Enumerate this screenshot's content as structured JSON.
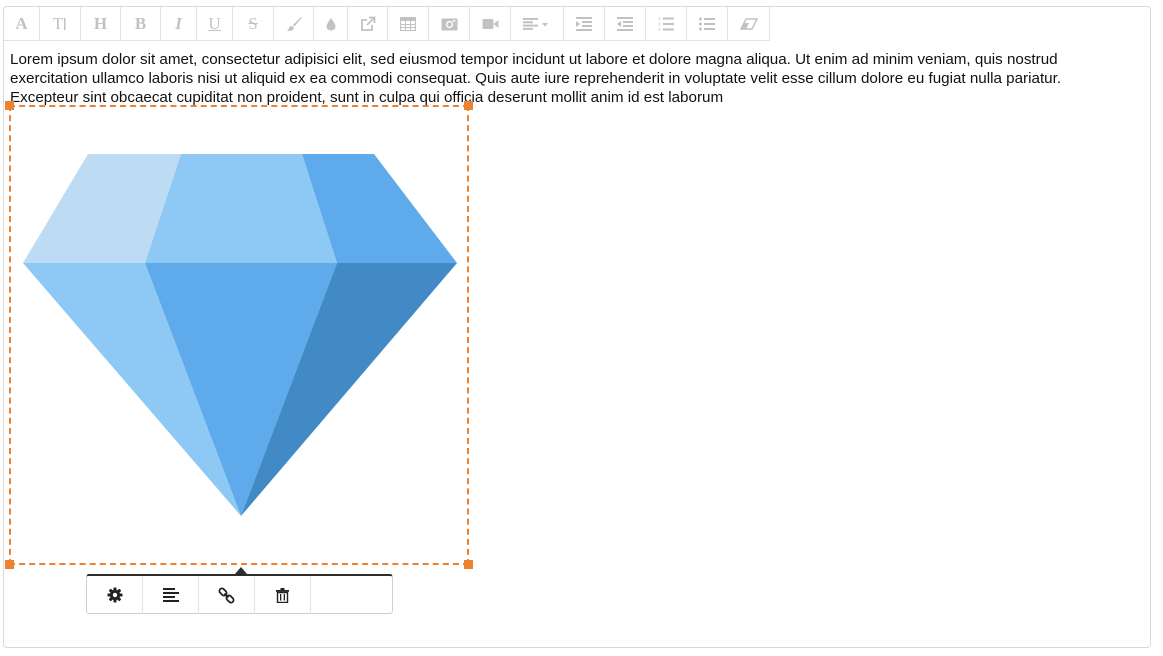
{
  "toolbar": {
    "buttons": [
      {
        "name": "font-family-button",
        "glyph": "A"
      },
      {
        "name": "font-size-button",
        "glyph": "T"
      },
      {
        "name": "heading-button",
        "glyph": "H"
      },
      {
        "name": "bold-button",
        "glyph": "B"
      },
      {
        "name": "italic-button",
        "glyph": "I"
      },
      {
        "name": "underline-button",
        "glyph": "U"
      },
      {
        "name": "strikethrough-button",
        "glyph": "S"
      },
      {
        "name": "paint-brush-button",
        "icon": "brush-icon"
      },
      {
        "name": "text-color-button",
        "icon": "droplet-icon"
      },
      {
        "name": "insert-link-button",
        "icon": "external-link-icon"
      },
      {
        "name": "insert-table-button",
        "icon": "table-icon"
      },
      {
        "name": "insert-image-button",
        "icon": "camera-icon"
      },
      {
        "name": "insert-video-button",
        "icon": "video-camera-icon"
      },
      {
        "name": "align-dropdown-button",
        "icon": "align-left-caret-icon"
      },
      {
        "name": "indent-button",
        "icon": "indent-icon"
      },
      {
        "name": "outdent-button",
        "icon": "outdent-icon"
      },
      {
        "name": "ordered-list-button",
        "icon": "ordered-list-icon"
      },
      {
        "name": "unordered-list-button",
        "icon": "unordered-list-icon"
      },
      {
        "name": "clear-format-button",
        "icon": "eraser-icon"
      }
    ]
  },
  "content": {
    "paragraph": "Lorem ipsum dolor sit amet, consectetur adipisici elit, sed eiusmod tempor incidunt ut labore et dolore magna aliqua. Ut enim ad minim veniam, quis nostrud exercitation ullamco laboris nisi ut aliquid ex ea commodi consequat. Quis aute iure reprehenderit in voluptate velit esse cillum dolore eu fugiat nulla pariatur. Excepteur sint obcaecat cupiditat non proident, sunt in culpa qui officia deserunt mollit anim id est laborum"
  },
  "image": {
    "subject": "diamond",
    "selected": true
  },
  "image_popover": {
    "buttons": [
      {
        "name": "image-settings-button",
        "icon": "gear-icon"
      },
      {
        "name": "image-align-button",
        "icon": "align-left-icon"
      },
      {
        "name": "image-link-button",
        "icon": "link-icon"
      },
      {
        "name": "image-delete-button",
        "icon": "trash-icon"
      }
    ]
  },
  "colors": {
    "accent": "#ee8233",
    "toolbar_icon": "#c2c2c2",
    "diamond_light": "#bddcf4",
    "diamond_mid": "#8ec9f6",
    "diamond_base": "#5eaaea",
    "diamond_dark": "#428ac5"
  }
}
